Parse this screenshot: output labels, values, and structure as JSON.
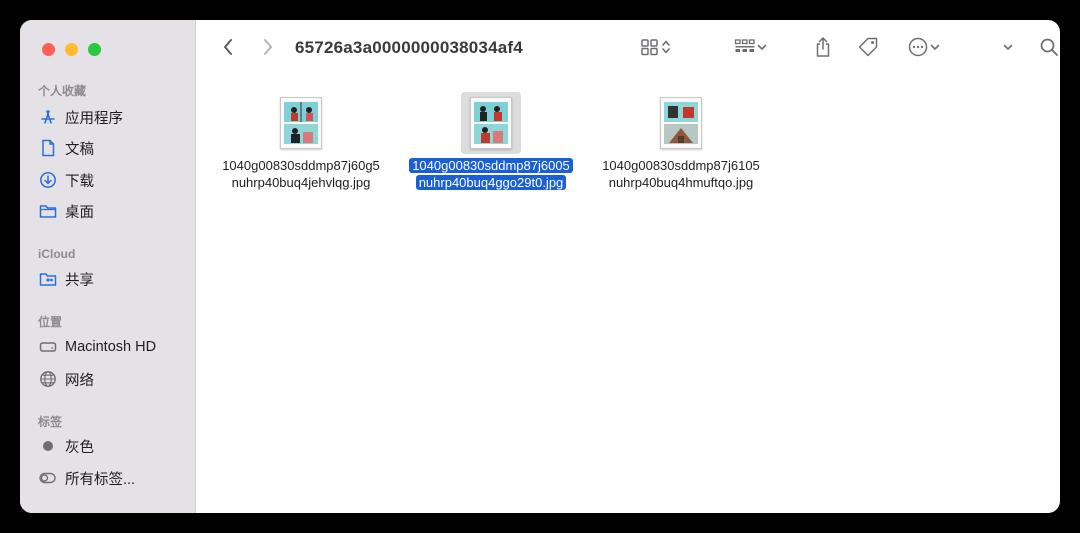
{
  "window": {
    "title": "65726a3a0000000038034af4"
  },
  "sidebar": {
    "sections": [
      {
        "header": "个人收藏",
        "items": [
          {
            "label": "应用程序",
            "icon": "applications-icon"
          },
          {
            "label": "文稿",
            "icon": "document-icon"
          },
          {
            "label": "下载",
            "icon": "download-icon"
          },
          {
            "label": "桌面",
            "icon": "folder-icon"
          }
        ]
      },
      {
        "header": "iCloud",
        "items": [
          {
            "label": "共享",
            "icon": "shared-folder-icon"
          }
        ]
      },
      {
        "header": "位置",
        "items": [
          {
            "label": "Macintosh HD",
            "icon": "disk-icon"
          },
          {
            "label": "网络",
            "icon": "globe-icon"
          }
        ]
      },
      {
        "header": "标签",
        "items": [
          {
            "label": "灰色",
            "icon": "gray-tag-icon"
          },
          {
            "label": "所有标签...",
            "icon": "all-tags-icon"
          }
        ]
      }
    ]
  },
  "files": [
    {
      "line1": "1040g00830sddmp87j60g5",
      "line2": "nuhrp40buq4jehvlqg.jpg",
      "selected": false
    },
    {
      "line1": "1040g00830sddmp87j6005",
      "line2": "nuhrp40buq4ggo29t0.jpg",
      "selected": true
    },
    {
      "line1": "1040g00830sddmp87j6105",
      "line2": "nuhrp40buq4hmuftqo.jpg",
      "selected": false
    }
  ],
  "colors": {
    "selection": "#1a5fd6",
    "sidebar_bg": "#e4e2e6",
    "tag_gray": "#6e6e6e"
  }
}
